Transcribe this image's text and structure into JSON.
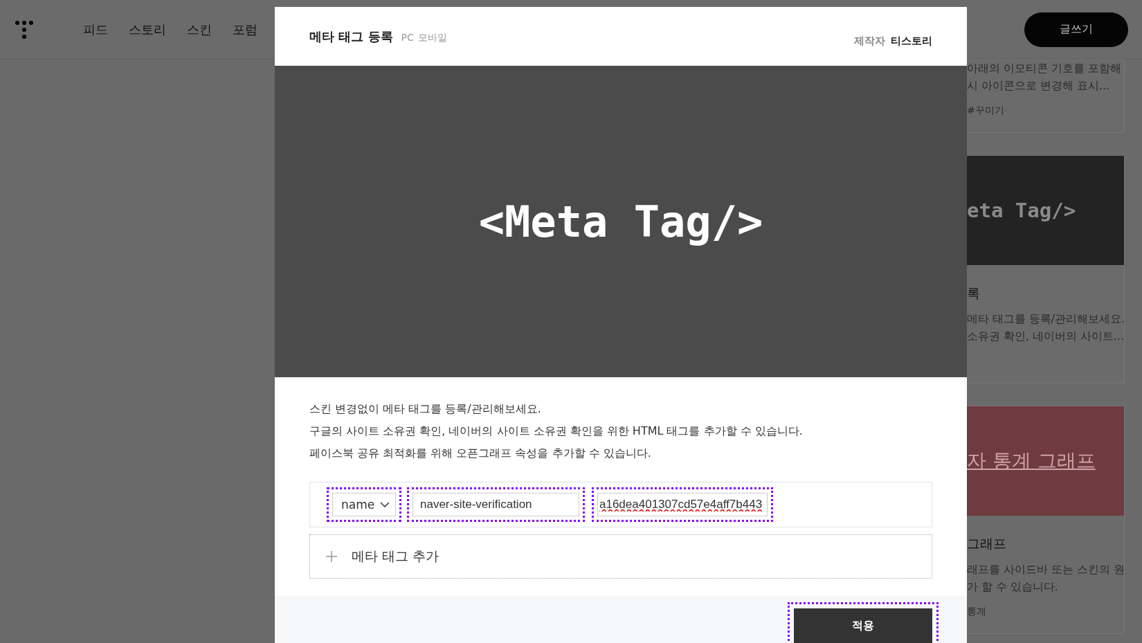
{
  "header": {
    "nav": [
      {
        "label": "피드"
      },
      {
        "label": "스토리"
      },
      {
        "label": "스킨"
      },
      {
        "label": "포럼"
      }
    ],
    "write_button": "글쓰기"
  },
  "cards": [
    {
      "lines": [
        "아래의 이모티콘 기호를 포함해",
        "시 아이콘으로 변경해 표시…"
      ],
      "tag": "#꾸미기"
    },
    {
      "image": {
        "kind": "code",
        "text": "eta Tag/>"
      },
      "title": "록",
      "lines": [
        "메타 태그를 등록/관리해보세요.",
        "소유권 확인, 네이버의 사이트…"
      ]
    },
    {
      "image": {
        "kind": "graph",
        "text": "자 통계 그래프"
      },
      "title": "그래프",
      "lines": [
        "래프를 사이드바 또는 스킨의 원",
        "가 할 수 있습니다."
      ],
      "tag": "통계"
    }
  ],
  "modal": {
    "title": "메타 태그 등록",
    "platforms": [
      "PC",
      "모바일"
    ],
    "author_label": "제작자",
    "author": "티스토리",
    "preview": "<Meta Tag/>",
    "description": [
      "스킨 변경없이 메타 태그를 등록/관리해보세요.",
      "구글의 사이트 소유권 확인, 네이버의 사이트 소유권 확인을 위한 HTML 태그를 추가할 수 있습니다.",
      "페이스북 공유 최적화를 위해 오픈그래프 속성을 추가할 수 있습니다."
    ],
    "tags": [
      {
        "attribute": "name",
        "key": "naver-site-verification",
        "content": "a16dea401307cd57e4aff7b443",
        "spell_error": true
      }
    ],
    "add_button": "메타 태그 추가",
    "apply_button": "적용"
  }
}
